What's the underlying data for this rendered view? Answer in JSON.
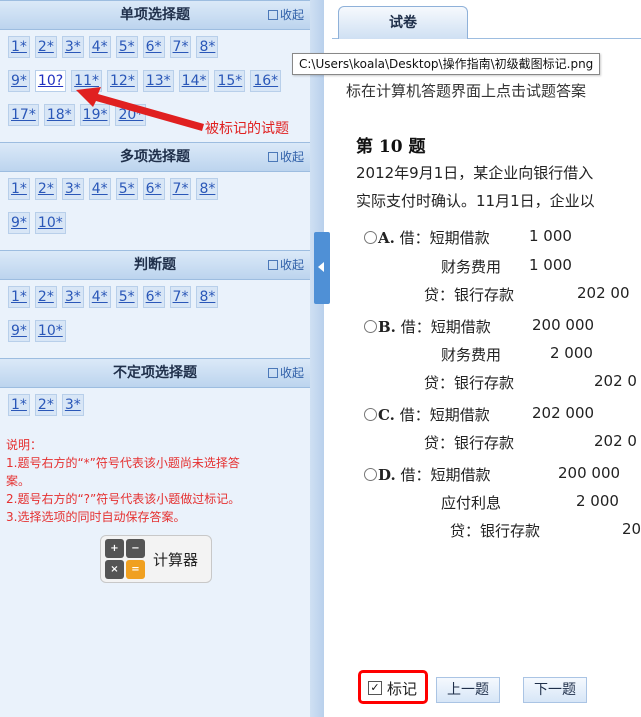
{
  "colors": {
    "accent": "#2a57b8",
    "annotation": "#e02020",
    "mark_border": "#ff0000"
  },
  "sections": [
    {
      "title": "单项选择题",
      "collapse": "收起",
      "rows": [
        [
          "1*",
          "2*",
          "3*",
          "4*",
          "5*",
          "6*",
          "7*",
          "8*"
        ],
        [
          "9*",
          "10?",
          "11*",
          "12*",
          "13*",
          "14*",
          "15*",
          "16*"
        ],
        [
          "17*",
          "18*",
          "19*",
          "20*"
        ]
      ]
    },
    {
      "title": "多项选择题",
      "collapse": "收起",
      "rows": [
        [
          "1*",
          "2*",
          "3*",
          "4*",
          "5*",
          "6*",
          "7*",
          "8*"
        ],
        [
          "9*",
          "10*"
        ]
      ]
    },
    {
      "title": "判断题",
      "collapse": "收起",
      "rows": [
        [
          "1*",
          "2*",
          "3*",
          "4*",
          "5*",
          "6*",
          "7*",
          "8*"
        ],
        [
          "9*",
          "10*"
        ]
      ]
    },
    {
      "title": "不定项选择题",
      "collapse": "收起",
      "rows": [
        [
          "1*",
          "2*",
          "3*"
        ]
      ]
    }
  ],
  "notes": {
    "head": "说明：",
    "l1a": "1.题号右方的“*”符号代表该小题尚未选择答",
    "l1b": "案。",
    "l2": "2.题号右方的“?”符号代表该小题做过标记。",
    "l3": "3.选择选项的同时自动保存答案。"
  },
  "calculator": {
    "label": "计算器",
    "icon": "calculator-icon"
  },
  "annotation": {
    "text": "被标记的试题"
  },
  "tooltip": {
    "text": "C:\\Users\\koala\\Desktop\\操作指南\\初级截图标记.png"
  },
  "tab": {
    "label": "试卷"
  },
  "question": {
    "top_line": "标在计算机答题界面上点击试题答案",
    "title": "第 10 题",
    "text1": "2012年9月1日，某企业向银行借入",
    "text2": "实际支付时确认。11月1日，企业以",
    "options": [
      {
        "key": "A.",
        "lines": [
          [
            "借：短期借款",
            "1 000"
          ],
          [
            "财务费用",
            "1 000"
          ],
          [
            "贷：银行存款",
            "202 00"
          ]
        ]
      },
      {
        "key": "B.",
        "lines": [
          [
            "借：短期借款",
            "200 000"
          ],
          [
            "财务费用",
            "2 000"
          ],
          [
            "贷：银行存款",
            "202 0"
          ]
        ]
      },
      {
        "key": "C.",
        "lines": [
          [
            "借：短期借款",
            "202 000"
          ],
          [
            "贷：银行存款",
            "202 0"
          ]
        ]
      },
      {
        "key": "D.",
        "lines": [
          [
            "借：短期借款",
            "200 000"
          ],
          [
            "应付利息",
            "2 000"
          ],
          [
            "贷：银行存款",
            "20"
          ]
        ]
      }
    ]
  },
  "footer": {
    "mark_label": "标记",
    "mark_checked": true,
    "prev": "上一题",
    "next": "下一题"
  }
}
